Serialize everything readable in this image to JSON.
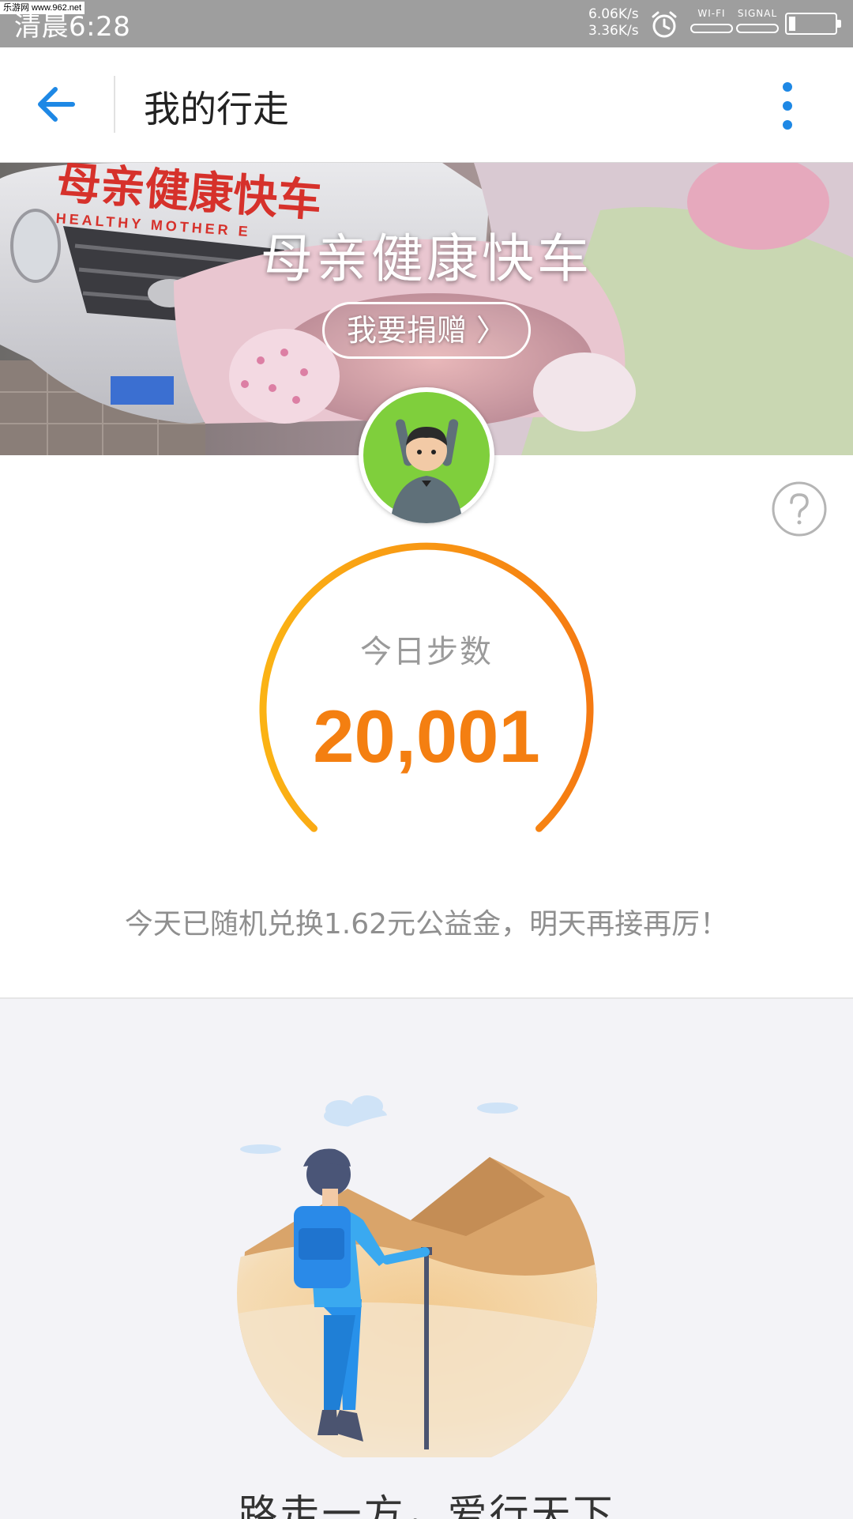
{
  "status_bar": {
    "watermark": "乐游网 www.962.net",
    "time": "清晨6:28",
    "download_speed": "6.06K/s",
    "upload_speed": "3.36K/s",
    "wifi_label": "WI-FI",
    "signal_label": "SIGNAL",
    "battery_level": 0.15
  },
  "header": {
    "title": "我的行走"
  },
  "banner": {
    "title": "母亲健康快车",
    "vehicle_text": "母亲健康快车",
    "vehicle_text_en": "HEALTHY MOTHER E",
    "donate_label": "我要捐赠 〉"
  },
  "steps": {
    "label": "今日步数",
    "value": "20,001",
    "note": "今天已随机兑换1.62元公益金，明天再接再厉！"
  },
  "bottom": {
    "slogan": "路走一方，爱行天下"
  },
  "colors": {
    "accent_blue": "#1e88e5",
    "step_orange": "#f47f11",
    "gauge_start": "#fbb314",
    "gauge_end": "#f57a12"
  }
}
